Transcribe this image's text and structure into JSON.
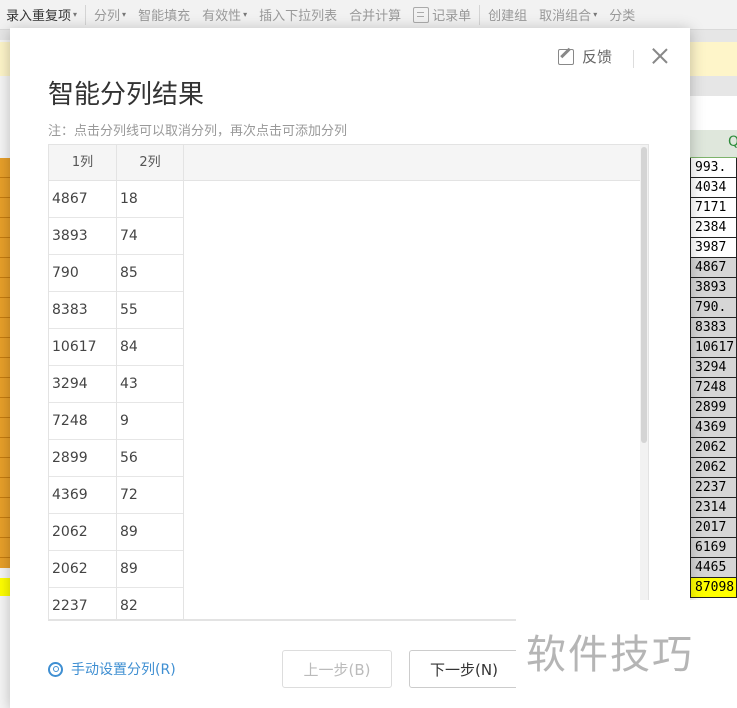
{
  "toolbar": {
    "items": [
      {
        "label": "录入重复项",
        "caret": "▾",
        "dark": true
      },
      {
        "label": "分列",
        "caret": "▾"
      },
      {
        "label": "智能填充"
      },
      {
        "label": "有效性",
        "caret": "▾"
      },
      {
        "label": "插入下拉列表"
      },
      {
        "label": "合并计算"
      },
      {
        "label": "记录单",
        "icon": "form-icon"
      },
      {
        "label": "创建组"
      },
      {
        "label": "取消组合",
        "caret": "▾"
      },
      {
        "label": "分类"
      }
    ]
  },
  "sheet": {
    "column_header": "Q",
    "cells": [
      "993.",
      "4034",
      "7171",
      "2384",
      "3987",
      "4867",
      "3893",
      "790.",
      "8383",
      "10617",
      "3294",
      "7248",
      "2899",
      "4369",
      "2062",
      "2062",
      "2237",
      "2314",
      "2017",
      "6169",
      "4465",
      "87098"
    ],
    "gray_rows_from": 5
  },
  "dialog": {
    "title": "智能分列结果",
    "note": "注：点击分列线可以取消分列，再次点击可添加分列",
    "feedback_label": "反馈",
    "manual_label": "手动设置分列(R)",
    "prev_label": "上一步(B)",
    "next_label": "下一步(N)",
    "preview": {
      "headers": [
        "1列",
        "2列"
      ],
      "rows": [
        [
          "4867",
          "18"
        ],
        [
          "3893",
          "74"
        ],
        [
          "790",
          "85"
        ],
        [
          "8383",
          "55"
        ],
        [
          "10617",
          "84"
        ],
        [
          "3294",
          "43"
        ],
        [
          "7248",
          "9"
        ],
        [
          "2899",
          "56"
        ],
        [
          "4369",
          "72"
        ],
        [
          "2062",
          "89"
        ],
        [
          "2062",
          "89"
        ],
        [
          "2237",
          "82"
        ]
      ]
    }
  },
  "watermark": "软件技巧"
}
